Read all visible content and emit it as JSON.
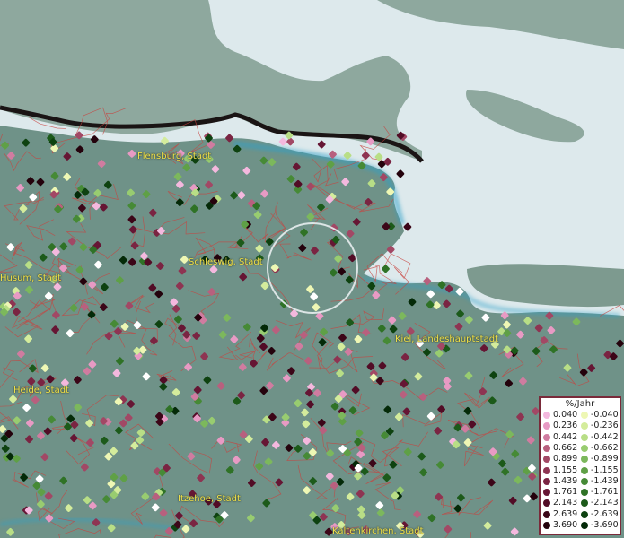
{
  "map": {
    "places": [
      {
        "id": "flensburg",
        "label": "Flensburg, Stadt"
      },
      {
        "id": "schleswig",
        "label": "Schleswig, Stadt"
      },
      {
        "id": "husum",
        "label": "Husum, Stadt"
      },
      {
        "id": "kiel",
        "label": "Kiel, Landeshauptstadt"
      },
      {
        "id": "heide",
        "label": "Heide, Stadt"
      },
      {
        "id": "itzehoe",
        "label": "Itzehoe, Stadt"
      },
      {
        "id": "kaltenkirchen",
        "label": "Kaltenkirchen, Stadt"
      }
    ]
  },
  "legend": {
    "title": "%/Jahr",
    "positive": [
      {
        "label": "0.040",
        "color": "#f4b8de"
      },
      {
        "label": "0.236",
        "color": "#e89ac4"
      },
      {
        "label": "0.442",
        "color": "#d07ca0"
      },
      {
        "label": "0.662",
        "color": "#b8607e"
      },
      {
        "label": "0.899",
        "color": "#a24865"
      },
      {
        "label": "1.155",
        "color": "#8e3452"
      },
      {
        "label": "1.439",
        "color": "#7a2442"
      },
      {
        "label": "1.761",
        "color": "#661634"
      },
      {
        "label": "2.143",
        "color": "#520c26"
      },
      {
        "label": "2.639",
        "color": "#3c0618"
      },
      {
        "label": "3.690",
        "color": "#24020c"
      }
    ],
    "negative": [
      {
        "label": "-0.040",
        "color": "#eef7b4"
      },
      {
        "label": "-0.236",
        "color": "#d4ec9c"
      },
      {
        "label": "-0.442",
        "color": "#b8de86"
      },
      {
        "label": "-0.662",
        "color": "#98cc70"
      },
      {
        "label": "-0.899",
        "color": "#7cb85c"
      },
      {
        "label": "-1.155",
        "color": "#5fa046"
      },
      {
        "label": "-1.439",
        "color": "#468a36"
      },
      {
        "label": "-1.761",
        "color": "#2f7226"
      },
      {
        "label": "-2.143",
        "color": "#1c5a1a"
      },
      {
        "label": "-2.639",
        "color": "#0e4210"
      },
      {
        "label": "-3.690",
        "color": "#042a08"
      }
    ]
  }
}
